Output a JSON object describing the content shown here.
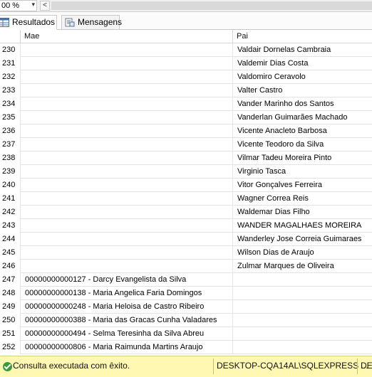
{
  "zoom": {
    "value": "00 %",
    "dropdown_glyph": "▾",
    "scroll_left_glyph": "<"
  },
  "tabs": [
    {
      "label": "Resultados",
      "active": true,
      "icon": "grid-icon"
    },
    {
      "label": "Mensagens",
      "active": false,
      "icon": "messages-icon"
    }
  ],
  "grid": {
    "columns": [
      "Mae",
      "Pai"
    ],
    "rows": [
      {
        "n": "230",
        "mae": "",
        "pai": "Valdair Dornelas Cambraia"
      },
      {
        "n": "231",
        "mae": "",
        "pai": "Valdemir Dias Costa"
      },
      {
        "n": "232",
        "mae": "",
        "pai": "Valdomiro Ceravolo"
      },
      {
        "n": "233",
        "mae": "",
        "pai": "Valter Castro"
      },
      {
        "n": "234",
        "mae": "",
        "pai": "Vander Marinho dos Santos"
      },
      {
        "n": "235",
        "mae": "",
        "pai": "Vanderlan Guimarães Machado"
      },
      {
        "n": "236",
        "mae": "",
        "pai": "Vicente Anacleto Barbosa"
      },
      {
        "n": "237",
        "mae": "",
        "pai": "Vicente Teodoro da Silva"
      },
      {
        "n": "238",
        "mae": "",
        "pai": "Vilmar Tadeu Moreira Pinto"
      },
      {
        "n": "239",
        "mae": "",
        "pai": "Virginio Tasca"
      },
      {
        "n": "240",
        "mae": "",
        "pai": "Vitor Gonçalves Ferreira"
      },
      {
        "n": "241",
        "mae": "",
        "pai": "Wagner Correa Reis"
      },
      {
        "n": "242",
        "mae": "",
        "pai": "Waldemar Dias Filho"
      },
      {
        "n": "243",
        "mae": "",
        "pai": "WANDER MAGALHAES MOREIRA"
      },
      {
        "n": "244",
        "mae": "",
        "pai": "Wanderley Jose Correia Guimaraes"
      },
      {
        "n": "245",
        "mae": "",
        "pai": "Wilson Dias de Araujo"
      },
      {
        "n": "246",
        "mae": "",
        "pai": "Zulmar Marques de Oliveira"
      },
      {
        "n": "247",
        "mae": "00000000000127 - Darcy Evangelista da Silva",
        "pai": ""
      },
      {
        "n": "248",
        "mae": "00000000000138 - Maria Angelica Faria Domingos",
        "pai": ""
      },
      {
        "n": "249",
        "mae": "00000000000248 - Maria Heloisa de Castro Ribeiro",
        "pai": ""
      },
      {
        "n": "250",
        "mae": "00000000000388 - Maria das Gracas Cunha Valadares",
        "pai": ""
      },
      {
        "n": "251",
        "mae": "00000000000494 - Selma Teresinha da Silva Abreu",
        "pai": ""
      },
      {
        "n": "252",
        "mae": "00000000000806 - Maria Raimunda Martins Araujo",
        "pai": ""
      }
    ]
  },
  "status": {
    "message": "Consulta executada com êxito.",
    "server": "DESKTOP-CQA14AL\\SQLEXPRESS ...",
    "next": "DES",
    "background": "#fff8b3",
    "success_color": "#3c9a3c"
  }
}
